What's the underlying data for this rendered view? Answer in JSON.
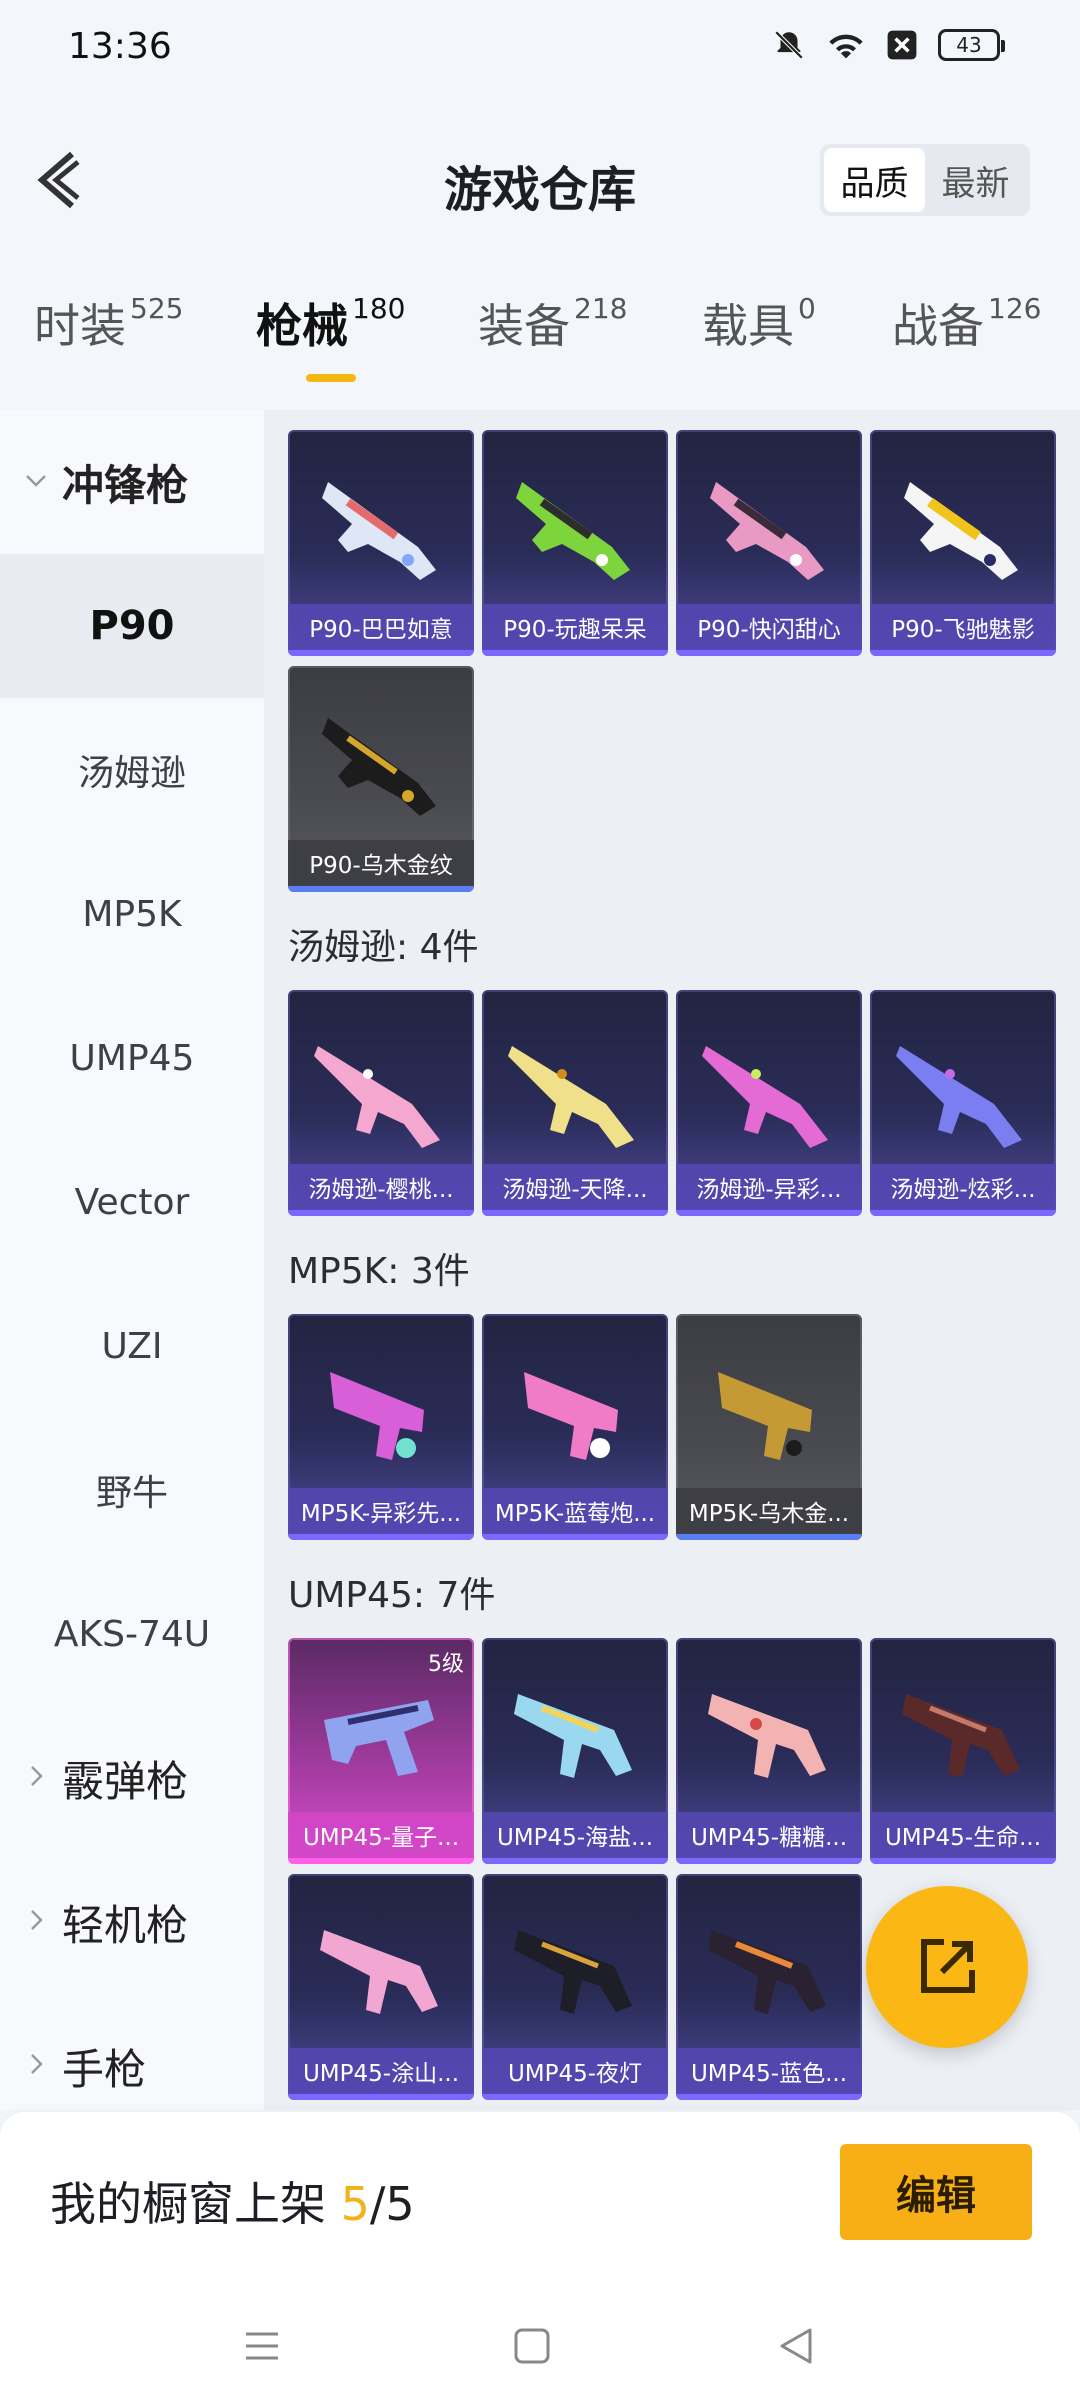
{
  "status": {
    "time": "13:36",
    "battery": "43"
  },
  "header": {
    "title": "游戏仓库",
    "sort": [
      "品质",
      "最新"
    ]
  },
  "tabs": [
    {
      "label": "时装",
      "count": "525"
    },
    {
      "label": "枪械",
      "count": "180"
    },
    {
      "label": "装备",
      "count": "218"
    },
    {
      "label": "载具",
      "count": "0"
    },
    {
      "label": "战备",
      "count": "126"
    }
  ],
  "sidebar": {
    "group_smg": "冲锋枪",
    "items": [
      "P90",
      "汤姆逊",
      "MP5K",
      "UMP45",
      "Vector",
      "UZI",
      "野牛",
      "AKS-74U"
    ],
    "group_shotgun": "霰弹枪",
    "group_lmg": "轻机枪",
    "group_pistol": "手枪"
  },
  "sections": {
    "p90": [
      "P90-巴巴如意",
      "P90-玩趣呆呆",
      "P90-快闪甜心",
      "P90-飞驰魅影",
      "P90-乌木金纹"
    ],
    "thompson_title": "汤姆逊: 4件",
    "thompson": [
      "汤姆逊-樱桃...",
      "汤姆逊-天降...",
      "汤姆逊-异彩...",
      "汤姆逊-炫彩..."
    ],
    "mp5k_title": "MP5K: 3件",
    "mp5k": [
      "MP5K-异彩先...",
      "MP5K-蓝莓炮...",
      "MP5K-乌木金..."
    ],
    "ump45_title": "UMP45: 7件",
    "ump45": [
      "UMP45-量子...",
      "UMP45-海盐...",
      "UMP45-糖糖...",
      "UMP45-生命...",
      "UMP45-涂山...",
      "UMP45-夜灯",
      "UMP45-蓝色..."
    ],
    "ump45_level": "5级"
  },
  "bottom": {
    "showcase_label": "我的橱窗上架 ",
    "showcase_count": "5",
    "showcase_total": "/5",
    "edit": "编辑"
  },
  "colors": {
    "accent": "#f8ae15",
    "card_purple": "#4f4b9d",
    "card_pink": "#d84fcb",
    "card_gold": "#5a5b61"
  },
  "icons": [
    "back-chevron-icon",
    "mute-bell-icon",
    "wifi-icon",
    "close-box-icon",
    "battery-icon",
    "share-out-icon",
    "menu-nav-icon",
    "home-nav-icon",
    "back-nav-icon"
  ]
}
